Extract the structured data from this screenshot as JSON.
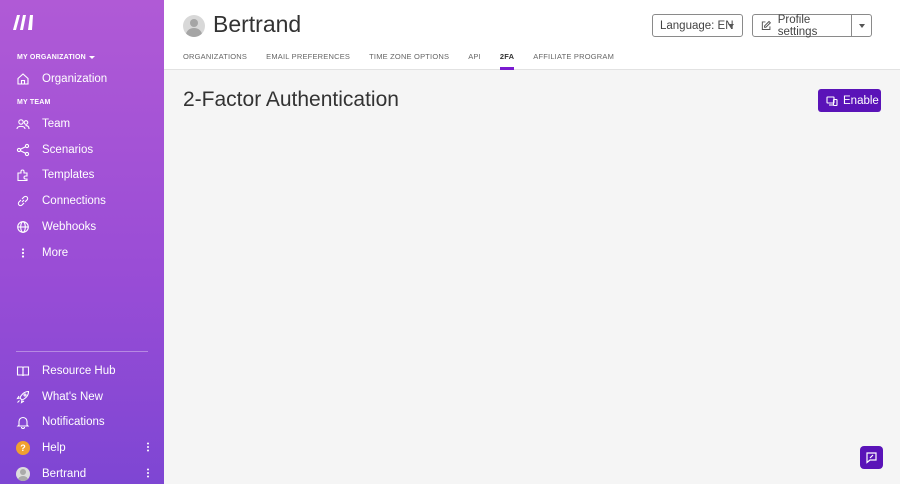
{
  "sidebar": {
    "org_section_label": "MY ORGANIZATION",
    "team_section_label": "MY TEAM",
    "org_items": [
      {
        "label": "Organization",
        "icon": "home-icon"
      }
    ],
    "team_items": [
      {
        "label": "Team",
        "icon": "users-icon"
      },
      {
        "label": "Scenarios",
        "icon": "share-icon"
      },
      {
        "label": "Templates",
        "icon": "puzzle-icon"
      },
      {
        "label": "Connections",
        "icon": "link-icon"
      },
      {
        "label": "Webhooks",
        "icon": "globe-icon"
      },
      {
        "label": "More",
        "icon": "more-vertical-icon"
      }
    ],
    "bottom_items": [
      {
        "label": "Resource Hub",
        "icon": "book-icon"
      },
      {
        "label": "What's New",
        "icon": "rocket-icon"
      },
      {
        "label": "Notifications",
        "icon": "bell-icon"
      },
      {
        "label": "Help",
        "icon": "help-icon"
      },
      {
        "label": "Bertrand",
        "icon": "avatar-icon"
      }
    ]
  },
  "header": {
    "user_name": "Bertrand",
    "language_button": "Language: EN",
    "profile_button": "Profile settings",
    "tabs": [
      {
        "label": "ORGANIZATIONS",
        "active": false
      },
      {
        "label": "EMAIL PREFERENCES",
        "active": false
      },
      {
        "label": "TIME ZONE OPTIONS",
        "active": false
      },
      {
        "label": "API",
        "active": false
      },
      {
        "label": "2FA",
        "active": true
      },
      {
        "label": "AFFILIATE PROGRAM",
        "active": false
      }
    ]
  },
  "main": {
    "title": "2-Factor Authentication",
    "enable_button": "Enable"
  },
  "colors": {
    "sidebar_top": "#b05ad6",
    "sidebar_bottom": "#7e46d3",
    "accent": "#5a13b8",
    "tab_underline": "#7a1bd0"
  }
}
